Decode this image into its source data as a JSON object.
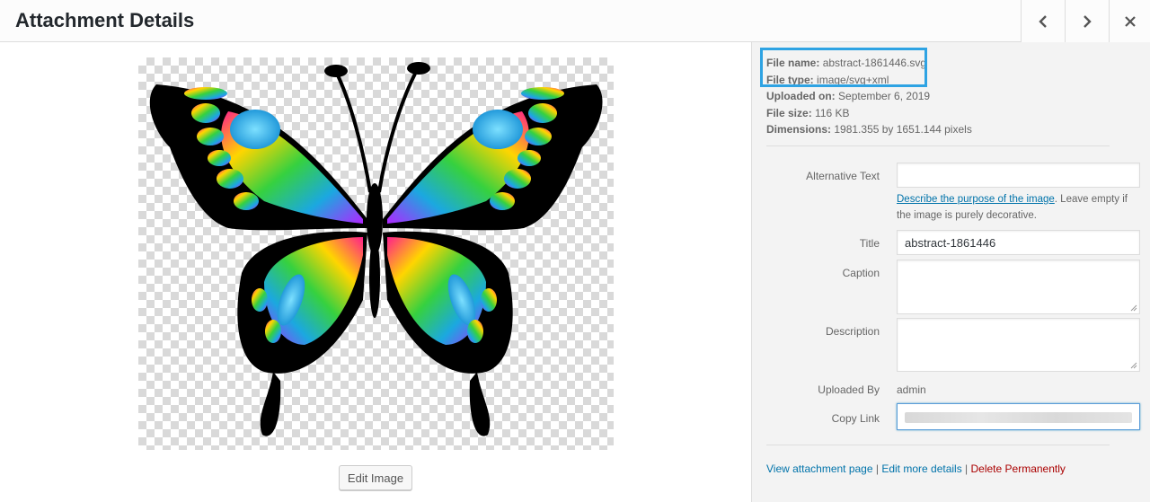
{
  "header": {
    "title": "Attachment Details",
    "prev_icon": "chevron-left-icon",
    "next_icon": "chevron-right-icon",
    "close_icon": "close-icon"
  },
  "media": {
    "edit_label": "Edit Image"
  },
  "file_info": {
    "name_label": "File name:",
    "name_value": "abstract-1861446.svg",
    "type_label": "File type:",
    "type_value": "image/svg+xml",
    "uploaded_label": "Uploaded on:",
    "uploaded_value": "September 6, 2019",
    "size_label": "File size:",
    "size_value": "116 KB",
    "dims_label": "Dimensions:",
    "dims_value": "1981.355 by 1651.144 pixels"
  },
  "form": {
    "alt_label": "Alternative Text",
    "alt_value": "",
    "alt_help_link": "Describe the purpose of the image",
    "alt_help_rest": ". Leave empty if the image is purely decorative.",
    "title_label": "Title",
    "title_value": "abstract-1861446",
    "caption_label": "Caption",
    "caption_value": "",
    "description_label": "Description",
    "description_value": "",
    "uploaded_by_label": "Uploaded By",
    "uploaded_by_value": "admin",
    "copy_link_label": "Copy Link"
  },
  "actions": {
    "view": "View attachment page",
    "sep1": " | ",
    "edit": "Edit more details",
    "sep2": " | ",
    "delete": "Delete Permanently"
  },
  "colors": {
    "accent": "#2ea3e3",
    "link": "#0073aa",
    "danger": "#aa0000"
  }
}
